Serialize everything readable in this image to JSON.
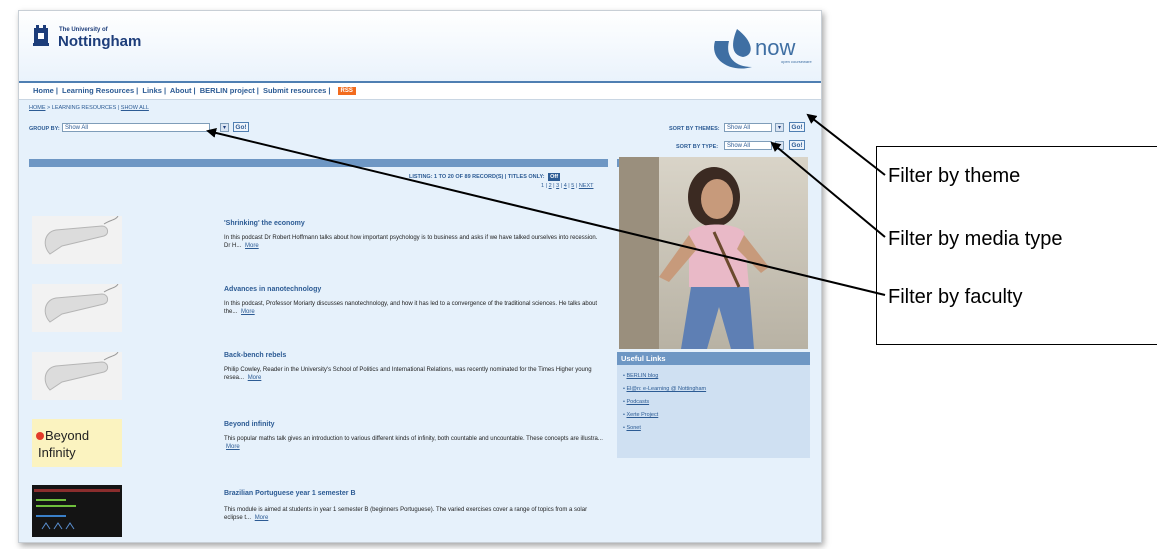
{
  "header": {
    "university_small": "The University of",
    "university_big": "Nottingham",
    "brand": "now",
    "brand_sub": "open courseware"
  },
  "nav": {
    "items": [
      "Home",
      "Learning Resources",
      "Links",
      "About",
      "BERLIN project",
      "Submit resources"
    ],
    "rss": "RSS"
  },
  "breadcrumb": {
    "home": "HOME",
    "current": "LEARNING RESOURCES",
    "show_all": "SHOW ALL"
  },
  "filters": {
    "group_label": "GROUP BY:",
    "group_value": "Show All",
    "go": "Go!",
    "theme_label": "SORT BY THEMES:",
    "theme_value": "Show All",
    "type_label": "SORT BY TYPE:",
    "type_value": "Show All"
  },
  "listing": {
    "text": "LISTING: 1 TO 20 OF 89 RECORD(S)  |  TITLES ONLY:",
    "toggle": "Off",
    "pages": [
      "1",
      "2",
      "3",
      "4",
      "5"
    ],
    "next": "NEXT"
  },
  "items": [
    {
      "title": "'Shrinking' the economy",
      "desc": "In this podcast Dr Robert Hoffmann talks about how important psychology is to business and asks if we have talked ourselves into recession. Dr H...",
      "more": "More"
    },
    {
      "title": "Advances in nanotechnology",
      "desc": "In this podcast, Professor Moriarty discusses nanotechnology, and how it has led to a convergence of the traditional sciences. He talks about the...",
      "more": "More"
    },
    {
      "title": "Back-bench rebels",
      "desc": "Philip Cowley, Reader in the University's School of Politics and International Relations, was recently nominated for the Times Higher young resea...",
      "more": "More"
    },
    {
      "title": "Beyond infinity",
      "desc": "This popular maths talk gives an introduction to various different kinds of infinity, both countable and uncountable. These concepts are illustra...",
      "more": "More",
      "thumb_line1": "Beyond",
      "thumb_line2": "Infinity"
    },
    {
      "title": "Brazilian Portuguese year 1 semester B",
      "desc": "This module is aimed at students in year 1 semester B (beginners Portuguese). The varied exercises cover a range of topics from a solar eclipse t...",
      "more": "More"
    }
  ],
  "useful_links": {
    "heading": "Useful Links",
    "items": [
      "BERLIN blog",
      "El@n: e-Learning @ Nottingham",
      "Podcasts",
      "Xerte Project",
      "Sonet"
    ]
  },
  "annotations": {
    "theme": "Filter by theme",
    "media": "Filter by media type",
    "faculty": "Filter by faculty"
  }
}
